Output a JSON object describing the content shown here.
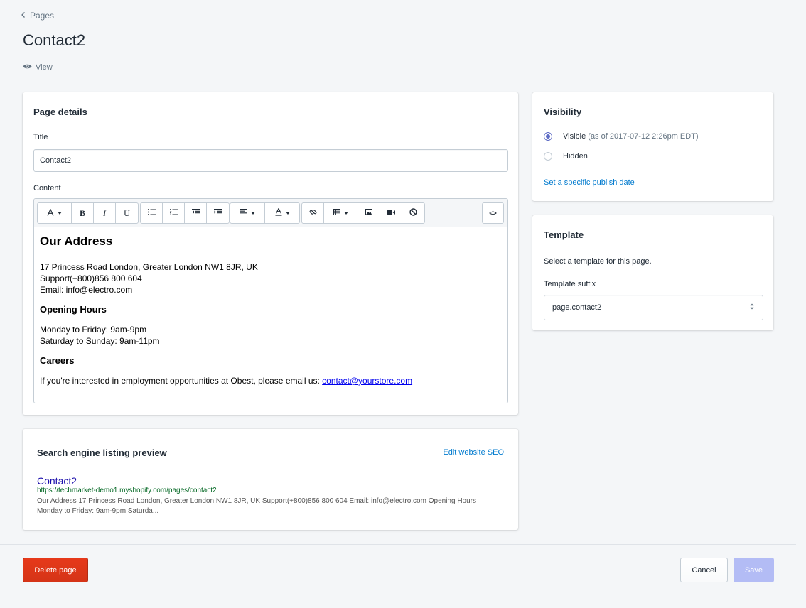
{
  "breadcrumb": {
    "label": "Pages"
  },
  "page": {
    "title": "Contact2",
    "view_label": "View"
  },
  "page_details": {
    "heading": "Page details",
    "title_label": "Title",
    "title_value": "Contact2",
    "content_label": "Content",
    "toolbar": {
      "font_icon": "font-letter-icon",
      "bold": "B",
      "italic": "I",
      "underline": "U",
      "source": "<>"
    },
    "content": {
      "heading": "Our Address",
      "address_line1": "17 Princess Road London, Greater London NW1 8JR, UK",
      "address_line2": "Support(+800)856 800 604",
      "address_line3": "Email: info@electro.com",
      "hours_heading": "Opening Hours",
      "hours_line1": "Monday to Friday: 9am-9pm",
      "hours_line2": "Saturday to Sunday: 9am-11pm",
      "careers_heading": "Careers",
      "careers_text": "If you're interested in employment opportunities at Obest, please email us: ",
      "careers_email": "contact@yourstore.com"
    }
  },
  "seo": {
    "heading": "Search engine listing preview",
    "edit_link": "Edit website SEO",
    "preview_title": "Contact2",
    "preview_url": "https://techmarket-demo1.myshopify.com/pages/contact2",
    "preview_description": "Our Address 17 Princess Road London, Greater London NW1 8JR, UK Support(+800)856 800 604 Email: info@electro.com Opening Hours Monday to Friday: 9am-9pm Saturda..."
  },
  "visibility": {
    "heading": "Visibility",
    "visible_label": "Visible",
    "visible_note": "(as of 2017-07-12 2:26pm EDT)",
    "hidden_label": "Hidden",
    "publish_link": "Set a specific publish date"
  },
  "template": {
    "heading": "Template",
    "description": "Select a template for this page.",
    "suffix_label": "Template suffix",
    "suffix_value": "page.contact2"
  },
  "footer": {
    "delete_label": "Delete page",
    "cancel_label": "Cancel",
    "save_label": "Save"
  },
  "colors": {
    "accent": "#5c6ac4",
    "link": "#007ace",
    "danger": "#de3618",
    "save_disabled": "#b3bcf5",
    "seo_title": "#1a0dab",
    "seo_url": "#006621"
  }
}
